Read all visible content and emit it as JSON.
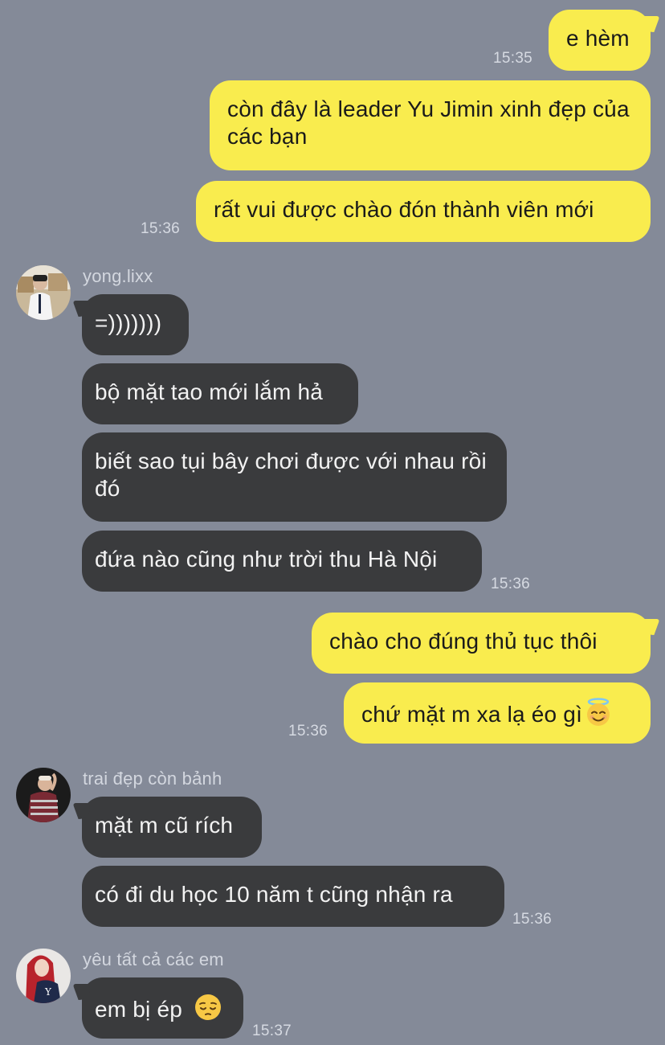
{
  "messages": [
    {
      "text": "e hèm",
      "time": "15:35"
    },
    {
      "text": "còn đây là leader Yu Jimin xinh đẹp của các bạn"
    },
    {
      "text": "rất vui được chào đón thành viên mới",
      "time": "15:36"
    },
    {
      "sender": "yong.lixx",
      "text": "=)))))))"
    },
    {
      "text": "bộ mặt tao mới lắm hả"
    },
    {
      "text": "biết sao tụi bây chơi được với nhau rồi đó"
    },
    {
      "text": "đứa nào cũng như trời thu Hà Nội",
      "time": "15:36"
    },
    {
      "text": "chào cho đúng thủ tục thôi"
    },
    {
      "text": "chứ mặt m xa lạ éo gì",
      "emoji": "smiling-face-with-halo",
      "time": "15:36"
    },
    {
      "sender": "trai đẹp còn bảnh",
      "text": "mặt m cũ rích"
    },
    {
      "text": "có đi du học 10 năm t cũng nhận ra",
      "time": "15:36"
    },
    {
      "sender": "yêu tất cả các em",
      "text": "em bị ép",
      "emoji": "pensive-face",
      "time": "15:37"
    }
  ],
  "colors": {
    "background": "#848a98",
    "outgoing_bubble": "#f9ec4e",
    "incoming_bubble": "#3a3b3d"
  }
}
